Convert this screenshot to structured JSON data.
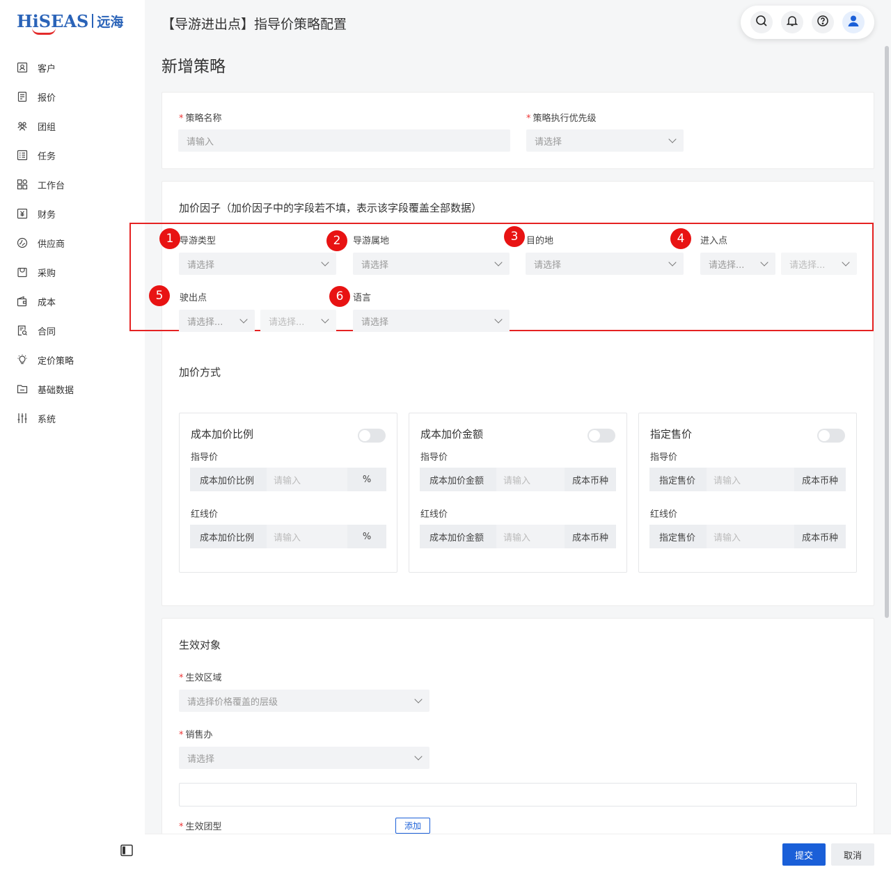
{
  "brand": {
    "logo_main": "HiSEAS",
    "logo_cn": "远海",
    "accent": "#2a63b8",
    "smile": "#e32b2b"
  },
  "sidebar": {
    "items": [
      {
        "label": "客户",
        "icon": "customer-icon"
      },
      {
        "label": "报价",
        "icon": "quote-icon"
      },
      {
        "label": "团组",
        "icon": "group-icon"
      },
      {
        "label": "任务",
        "icon": "task-icon"
      },
      {
        "label": "工作台",
        "icon": "workbench-icon"
      },
      {
        "label": "财务",
        "icon": "finance-icon"
      },
      {
        "label": "供应商",
        "icon": "supplier-icon"
      },
      {
        "label": "采购",
        "icon": "purchase-icon"
      },
      {
        "label": "成本",
        "icon": "wallet-icon"
      },
      {
        "label": "合同",
        "icon": "contract-icon"
      },
      {
        "label": "定价策略",
        "icon": "bulb-icon"
      },
      {
        "label": "基础数据",
        "icon": "folder-icon"
      },
      {
        "label": "系统",
        "icon": "sliders-icon"
      }
    ]
  },
  "header": {
    "title": "【导游进出点】指导价策略配置",
    "subtitle": "新增策略"
  },
  "basic": {
    "name_label": "策略名称",
    "name_placeholder": "请输入",
    "priority_label": "策略执行优先级",
    "priority_placeholder": "请选择"
  },
  "factors": {
    "title": "加价因子（加价因子中的字段若不填，表示该字段覆盖全部数据）",
    "badges": [
      "1",
      "2",
      "3",
      "4",
      "5",
      "6"
    ],
    "fields": {
      "guide_type": {
        "label": "导游类型",
        "placeholder": "请选择"
      },
      "guide_home": {
        "label": "导游属地",
        "placeholder": "请选择"
      },
      "destination": {
        "label": "目的地",
        "placeholder": "请选择"
      },
      "entry_point": {
        "label": "进入点",
        "placeholder_a": "请选择...",
        "placeholder_b": "请选择..."
      },
      "exit_point": {
        "label": "驶出点",
        "placeholder_a": "请选择...",
        "placeholder_b": "请选择..."
      },
      "language": {
        "label": "语言",
        "placeholder": "请选择"
      }
    }
  },
  "method": {
    "title": "加价方式",
    "cards": [
      {
        "title": "成本加价比例",
        "guide_label": "指导价",
        "red_label": "红线价",
        "prefix": "成本加价比例",
        "placeholder": "请输入",
        "suffix": "%"
      },
      {
        "title": "成本加价金额",
        "guide_label": "指导价",
        "red_label": "红线价",
        "prefix": "成本加价金额",
        "placeholder": "请输入",
        "suffix": "成本币种"
      },
      {
        "title": "指定售价",
        "guide_label": "指导价",
        "red_label": "红线价",
        "prefix": "指定售价",
        "placeholder": "请输入",
        "suffix": "成本币种"
      }
    ]
  },
  "target": {
    "title": "生效对象",
    "region_label": "生效区域",
    "region_placeholder": "请选择价格覆盖的层级",
    "office_label": "销售办",
    "office_placeholder": "请选择",
    "tour_type_label": "生效团型",
    "add_label": "添加"
  },
  "footer": {
    "submit": "提交",
    "cancel": "取消",
    "primary_color": "#1a5fd8"
  }
}
